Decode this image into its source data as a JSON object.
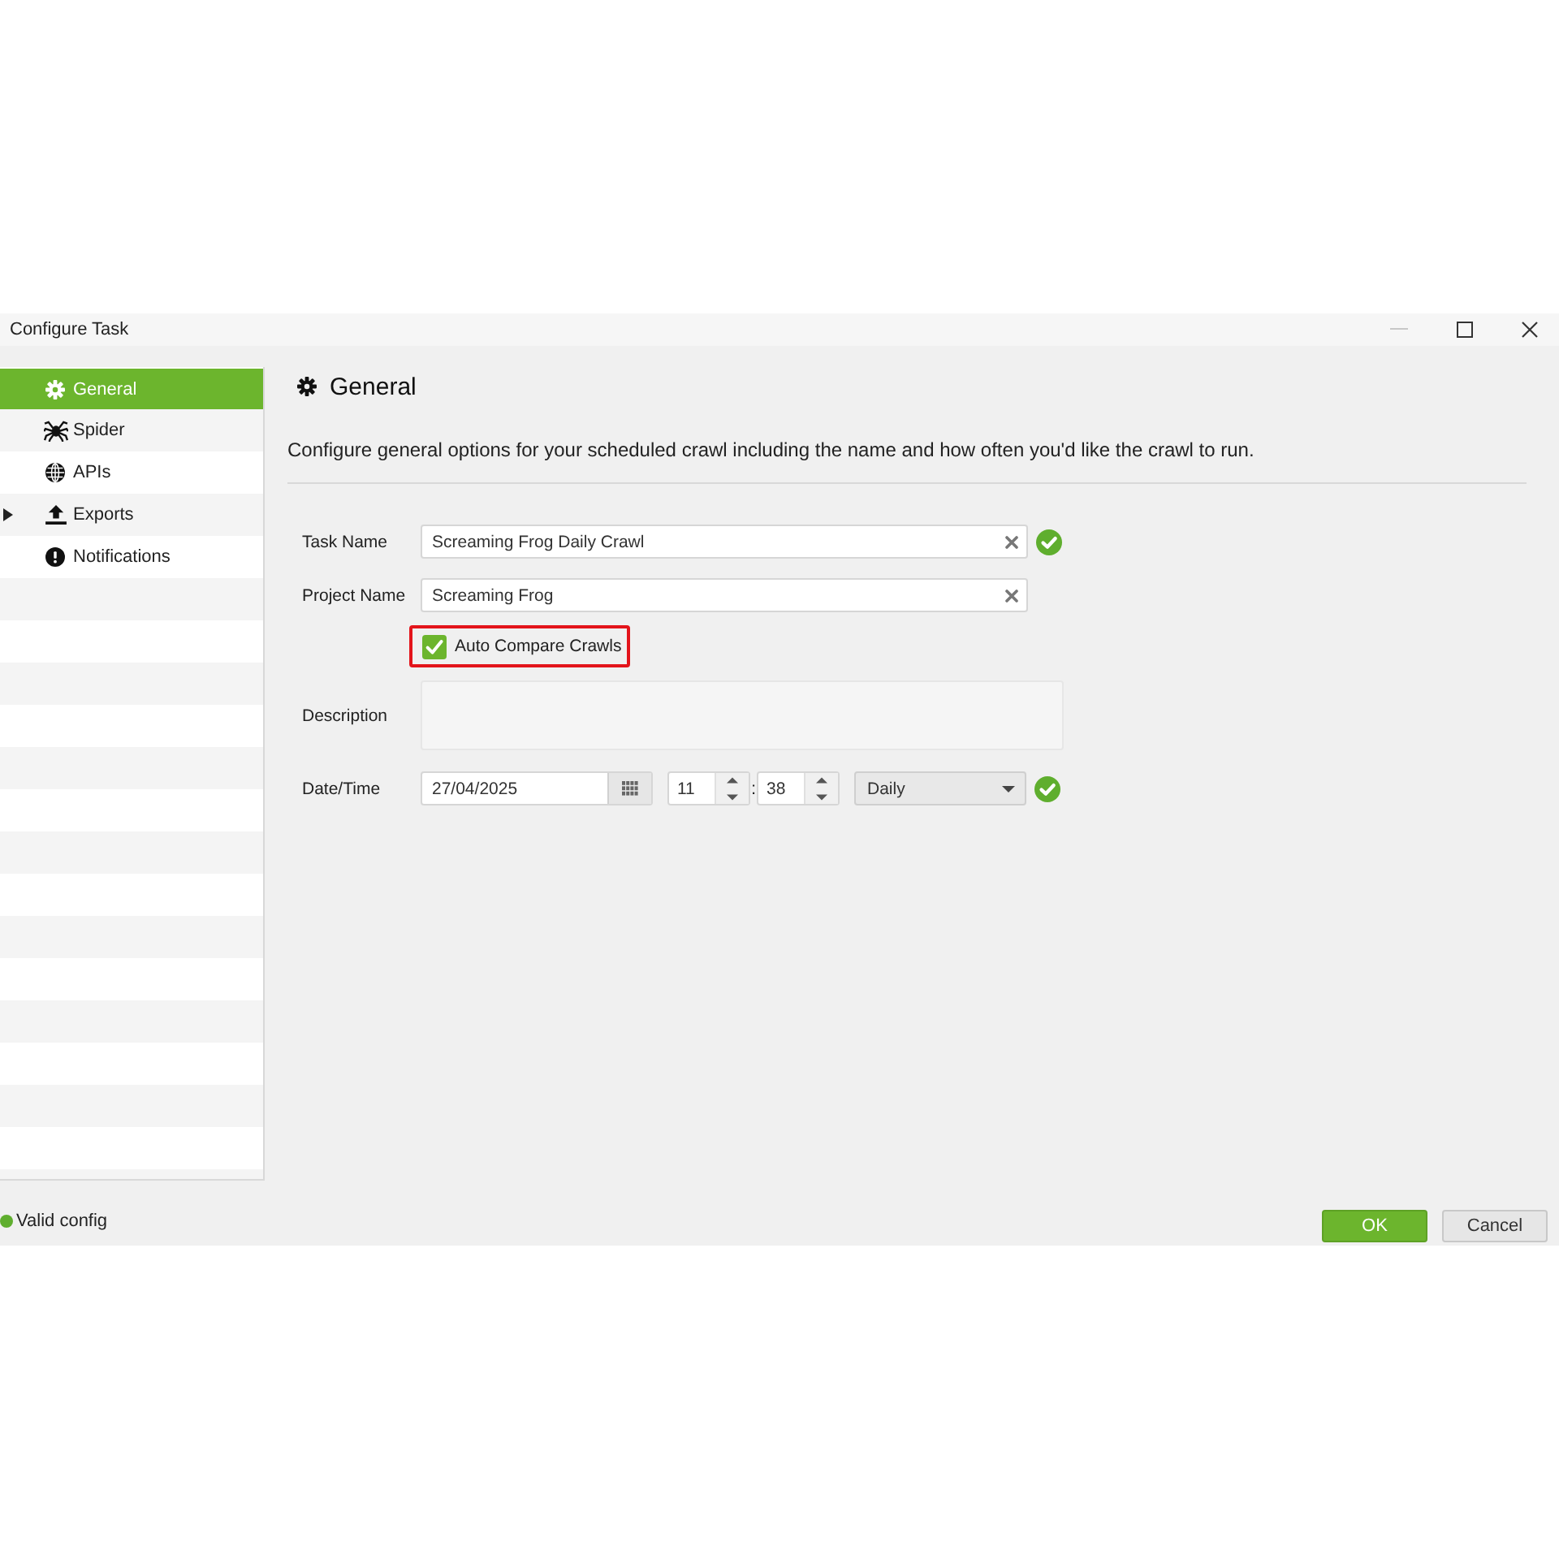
{
  "window": {
    "title": "Configure Task"
  },
  "sidebar": {
    "items": [
      {
        "label": "General",
        "selected": true,
        "kind": "item"
      },
      {
        "label": "Spider",
        "selected": false,
        "kind": "item"
      },
      {
        "label": "APIs",
        "selected": false,
        "kind": "item"
      },
      {
        "label": "Exports",
        "selected": false,
        "kind": "group",
        "expanded": false
      },
      {
        "label": "Notifications",
        "selected": false,
        "kind": "item"
      }
    ]
  },
  "page": {
    "title": "General",
    "description": "Configure general options for your scheduled crawl including the name and how often you'd like the crawl to run."
  },
  "form": {
    "task_name": {
      "label": "Task Name",
      "value": "Screaming Frog Daily Crawl",
      "valid": true
    },
    "project_name": {
      "label": "Project Name",
      "value": "Screaming Frog",
      "valid": false
    },
    "auto_compare": {
      "label": "Auto Compare Crawls",
      "checked": true,
      "highlighted": true
    },
    "description": {
      "label": "Description"
    },
    "date_time": {
      "label": "Date/Time",
      "date": "27/04/2025",
      "hour": "11",
      "separator": ":",
      "minute": "38",
      "frequency": "Daily",
      "valid": true
    }
  },
  "status_bar": {
    "text": "Valid config",
    "valid": true
  },
  "buttons": [
    {
      "label": "OK",
      "kind": "primary"
    },
    {
      "label": "Cancel",
      "kind": "secondary"
    }
  ]
}
